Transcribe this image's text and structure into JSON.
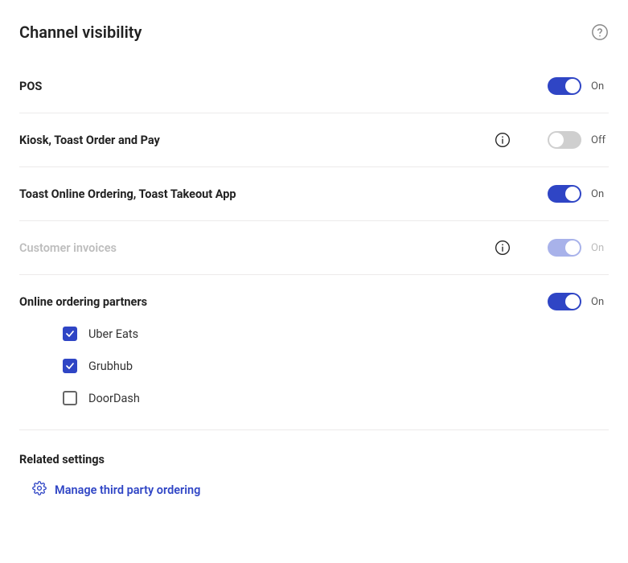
{
  "title": "Channel visibility",
  "states": {
    "on": "On",
    "off": "Off"
  },
  "channels": [
    {
      "key": "pos",
      "label": "POS",
      "info": false,
      "on": true,
      "disabled": false
    },
    {
      "key": "kiosk",
      "label": "Kiosk, Toast Order and Pay",
      "info": true,
      "on": false,
      "disabled": false
    },
    {
      "key": "olo",
      "label": "Toast Online Ordering, Toast Takeout App",
      "info": false,
      "on": true,
      "disabled": false
    },
    {
      "key": "inv",
      "label": "Customer invoices",
      "info": true,
      "on": true,
      "disabled": true
    }
  ],
  "partners": {
    "label": "Online ordering partners",
    "on": true,
    "items": [
      {
        "key": "ubereats",
        "label": "Uber Eats",
        "checked": true
      },
      {
        "key": "grubhub",
        "label": "Grubhub",
        "checked": true
      },
      {
        "key": "doordash",
        "label": "DoorDash",
        "checked": false
      }
    ]
  },
  "related": {
    "title": "Related settings",
    "link": "Manage third party ordering"
  }
}
